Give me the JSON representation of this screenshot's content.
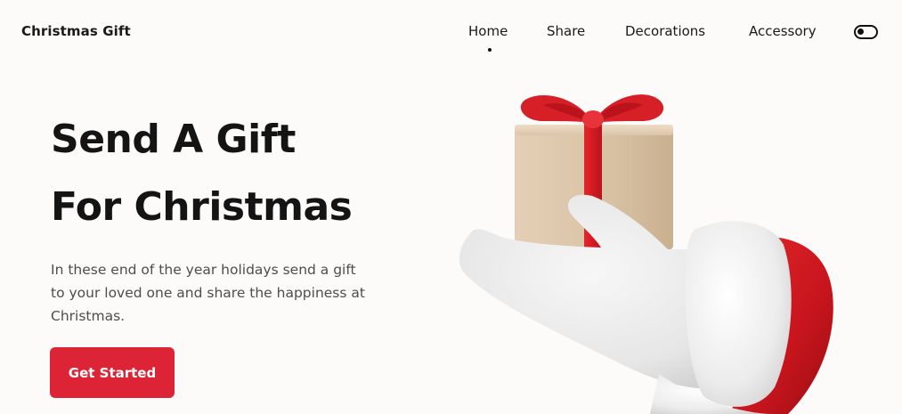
{
  "header": {
    "logo": "Christmas Gift",
    "nav": [
      {
        "label": "Home",
        "active": true
      },
      {
        "label": "Share"
      },
      {
        "label": "Decorations"
      },
      {
        "label": "Accessory"
      }
    ],
    "theme_toggle_icon": "toggle-icon"
  },
  "hero": {
    "title_line1": "Send A Gift",
    "title_line2": "For Christmas",
    "description": "In these end of the year holidays send a gift to your loved one and share the happiness at Christmas.",
    "cta_label": "Get Started",
    "image_icon": "santa-hand-with-gift",
    "accent_color": "#dc2436"
  }
}
